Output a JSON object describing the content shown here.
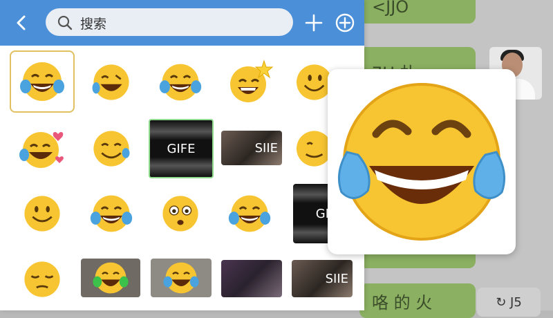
{
  "app": {
    "search": {
      "placeholder": "搜索"
    },
    "header": {
      "back_icon": "back-chevron-icon",
      "add_icon": "plus-icon",
      "add_circle_icon": "add-circle-icon"
    }
  },
  "background_chat": {
    "bubble_top_text": "<JJO",
    "bubble_mid_text": "ƎH 扑 ⊏",
    "bubble_bottom_text": "咯 的 火",
    "reply_chip_text": "↻ J5"
  },
  "emoji_grid": {
    "gif_labels": [
      "GIFE",
      "SIIE",
      "GI",
      "SIIE"
    ]
  },
  "colors": {
    "header_bg": "#4c8fd9",
    "selected_border": "#e0c060",
    "gif_border_green": "#8fdc8f",
    "bubble_green": "#8bb061"
  }
}
